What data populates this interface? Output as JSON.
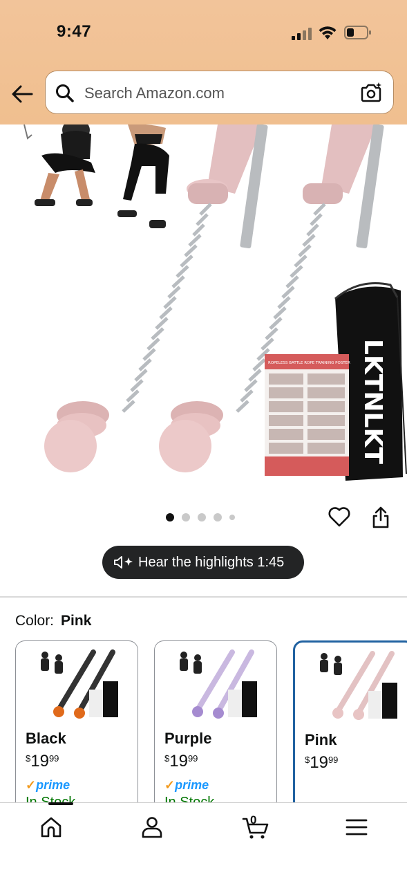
{
  "status": {
    "time": "9:47"
  },
  "search": {
    "placeholder": "Search Amazon.com"
  },
  "product": {
    "brand_text": "LKTNLKT",
    "poster_title": "ROPELESS BATTLE ROPE TRAINING POSTER"
  },
  "gallery": {
    "image_count": 5,
    "active_index": 0
  },
  "hear": {
    "label": "Hear the highlights 1:45"
  },
  "color": {
    "label": "Color:",
    "selected": "Pink"
  },
  "swatches": [
    {
      "name": "Black",
      "currency": "$",
      "whole": "19",
      "cents": "99",
      "prime": "prime",
      "stock": "In Stock",
      "color": "#222222"
    },
    {
      "name": "Purple",
      "currency": "$",
      "whole": "19",
      "cents": "99",
      "prime": "prime",
      "stock": "In Stock",
      "color": "#b9a3d8"
    },
    {
      "name": "Pink",
      "currency": "$",
      "whole": "19",
      "cents": "99",
      "color": "#e8c4c4"
    }
  ],
  "nav": {
    "cart_count": "0"
  },
  "colors": {
    "header": "#f0bf8f",
    "selected_border": "#2162a1",
    "prime": "#1a98ff",
    "stock": "#007600"
  }
}
